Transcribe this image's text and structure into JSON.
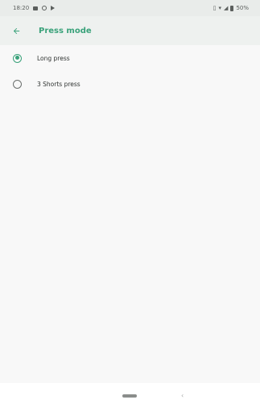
{
  "status_bar": {
    "time": "18:20",
    "battery_percent": "50%"
  },
  "app_bar": {
    "title": "Press mode",
    "back_icon": "arrow-back-icon"
  },
  "options": [
    {
      "label": "Long press",
      "selected": true
    },
    {
      "label": "3 Shorts press",
      "selected": false
    }
  ],
  "colors": {
    "accent": "#3aa27a",
    "status_bar_bg": "#e9ecea",
    "app_bar_bg": "#eef1ef"
  }
}
